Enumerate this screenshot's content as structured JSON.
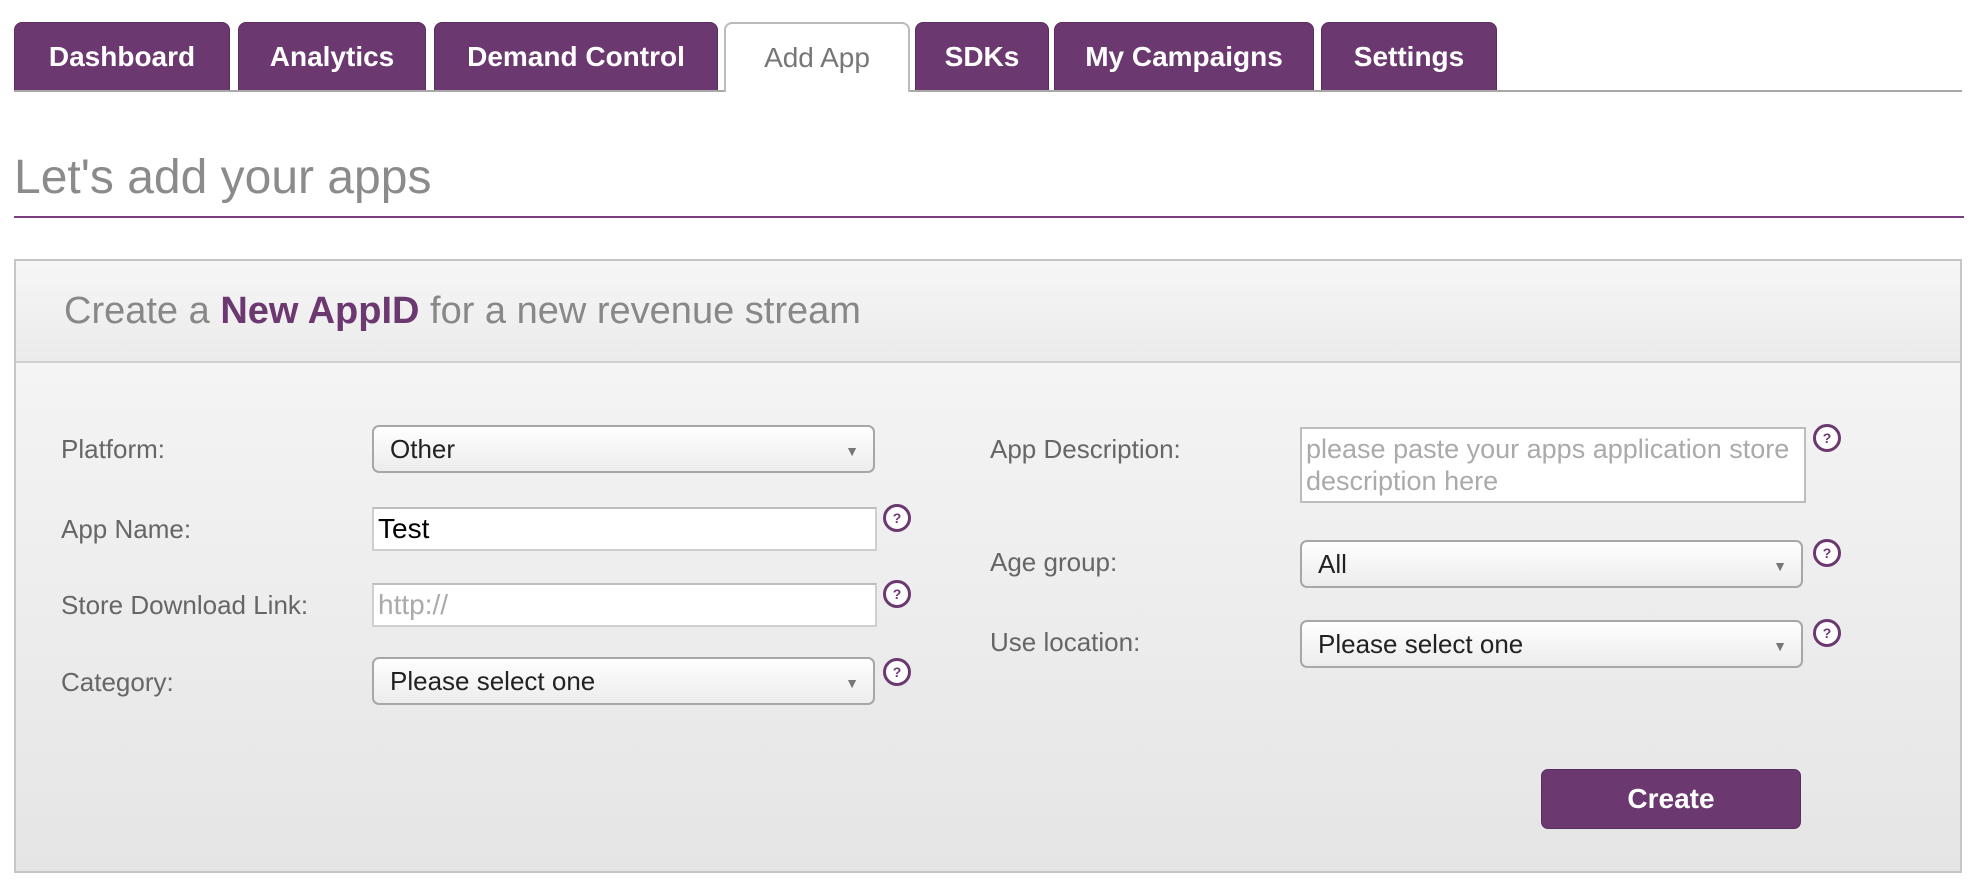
{
  "tabs": [
    {
      "label": "Dashboard"
    },
    {
      "label": "Analytics"
    },
    {
      "label": "Demand Control"
    },
    {
      "label": "Add App"
    },
    {
      "label": "SDKs"
    },
    {
      "label": "My Campaigns"
    },
    {
      "label": "Settings"
    }
  ],
  "active_tab": "Add App",
  "page": {
    "heading": "Let's add your apps"
  },
  "panel": {
    "title_prefix": "Create a ",
    "title_accent": "New AppID",
    "title_suffix": " for a new revenue stream"
  },
  "form": {
    "platform": {
      "label": "Platform:",
      "value": "Other"
    },
    "app_name": {
      "label": "App Name:",
      "value": "Test"
    },
    "store_link": {
      "label": "Store Download Link:",
      "placeholder": "http://"
    },
    "category": {
      "label": "Category:",
      "value": "Please select one"
    },
    "description": {
      "label": "App Description:",
      "placeholder": "please paste your apps application store description here"
    },
    "age_group": {
      "label": "Age group:",
      "value": "All"
    },
    "use_location": {
      "label": "Use location:",
      "value": "Please select one"
    },
    "help_glyph": "?",
    "caret_glyph": "▼",
    "create_label": "Create"
  },
  "colors": {
    "brand": "#6b3870",
    "heading": "#8b8b8b"
  }
}
